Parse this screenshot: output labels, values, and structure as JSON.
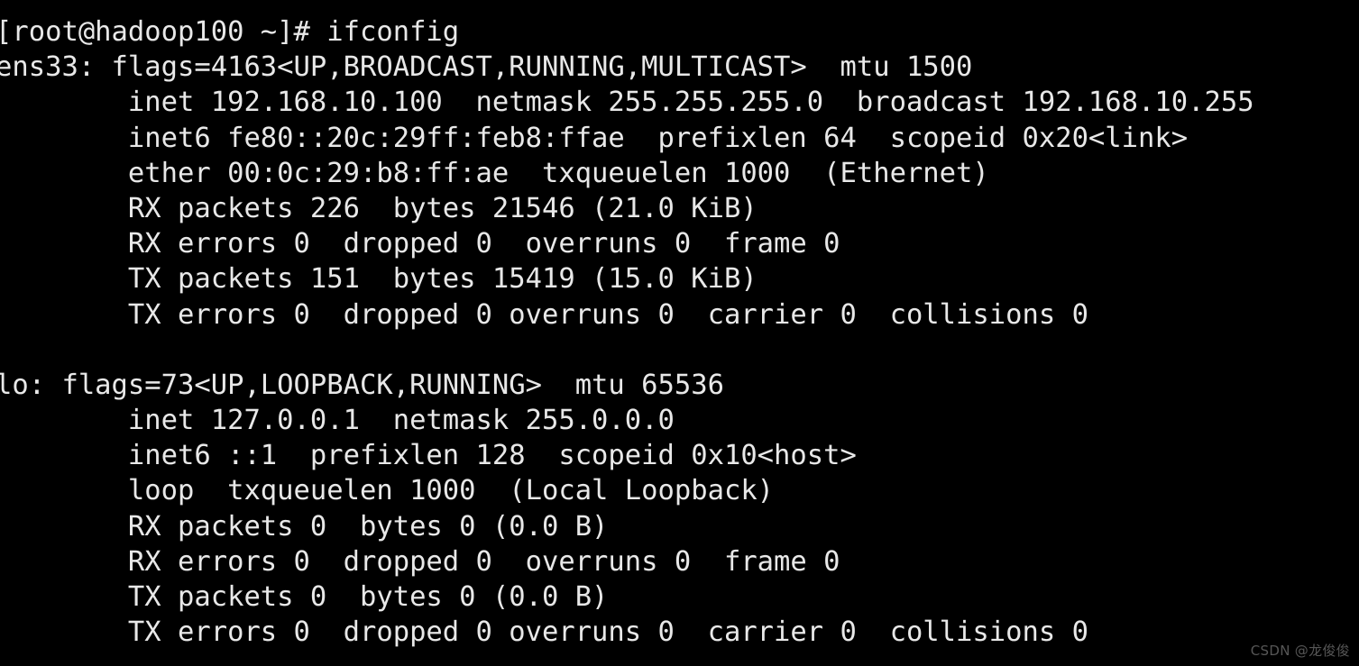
{
  "terminal": {
    "background_color": "#000000",
    "foreground_color": "#e8e8e8",
    "prompt": "[root@hadoop100 ~]#",
    "user": "root",
    "hostname": "hadoop100",
    "working_directory": "~",
    "command": "ifconfig",
    "lines": [
      "[root@hadoop100 ~]# ifconfig",
      "ens33: flags=4163<UP,BROADCAST,RUNNING,MULTICAST>  mtu 1500",
      "        inet 192.168.10.100  netmask 255.255.255.0  broadcast 192.168.10.255",
      "        inet6 fe80::20c:29ff:feb8:ffae  prefixlen 64  scopeid 0x20<link>",
      "        ether 00:0c:29:b8:ff:ae  txqueuelen 1000  (Ethernet)",
      "        RX packets 226  bytes 21546 (21.0 KiB)",
      "        RX errors 0  dropped 0  overruns 0  frame 0",
      "        TX packets 151  bytes 15419 (15.0 KiB)",
      "        TX errors 0  dropped 0 overruns 0  carrier 0  collisions 0",
      "",
      "lo: flags=73<UP,LOOPBACK,RUNNING>  mtu 65536",
      "        inet 127.0.0.1  netmask 255.0.0.0",
      "        inet6 ::1  prefixlen 128  scopeid 0x10<host>",
      "        loop  txqueuelen 1000  (Local Loopback)",
      "        RX packets 0  bytes 0 (0.0 B)",
      "        RX errors 0  dropped 0  overruns 0  frame 0",
      "        TX packets 0  bytes 0 (0.0 B)",
      "        TX errors 0  dropped 0 overruns 0  carrier 0  collisions 0"
    ],
    "interfaces": [
      {
        "name": "ens33",
        "flags_value": "4163",
        "flags": "UP,BROADCAST,RUNNING,MULTICAST",
        "mtu": "1500",
        "inet": "192.168.10.100",
        "netmask": "255.255.255.0",
        "broadcast": "192.168.10.255",
        "inet6": "fe80::20c:29ff:feb8:ffae",
        "prefixlen": "64",
        "scopeid": "0x20<link>",
        "ether": "00:0c:29:b8:ff:ae",
        "txqueuelen": "1000",
        "type": "Ethernet",
        "rx_packets": "226",
        "rx_bytes": "21546",
        "rx_bytes_human": "21.0 KiB",
        "rx_errors": "0",
        "rx_dropped": "0",
        "rx_overruns": "0",
        "rx_frame": "0",
        "tx_packets": "151",
        "tx_bytes": "15419",
        "tx_bytes_human": "15.0 KiB",
        "tx_errors": "0",
        "tx_dropped": "0",
        "tx_overruns": "0",
        "tx_carrier": "0",
        "tx_collisions": "0"
      },
      {
        "name": "lo",
        "flags_value": "73",
        "flags": "UP,LOOPBACK,RUNNING",
        "mtu": "65536",
        "inet": "127.0.0.1",
        "netmask": "255.0.0.0",
        "inet6": "::1",
        "prefixlen": "128",
        "scopeid": "0x10<host>",
        "loop": "loop",
        "txqueuelen": "1000",
        "type": "Local Loopback",
        "rx_packets": "0",
        "rx_bytes": "0",
        "rx_bytes_human": "0.0 B",
        "rx_errors": "0",
        "rx_dropped": "0",
        "rx_overruns": "0",
        "rx_frame": "0",
        "tx_packets": "0",
        "tx_bytes": "0",
        "tx_bytes_human": "0.0 B",
        "tx_errors": "0",
        "tx_dropped": "0",
        "tx_overruns": "0",
        "tx_carrier": "0",
        "tx_collisions": "0"
      }
    ]
  },
  "watermark": {
    "text": "CSDN @龙俊俊",
    "color": "#565656"
  }
}
